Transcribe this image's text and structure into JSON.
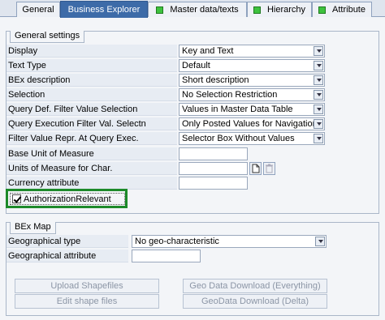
{
  "tabs": [
    {
      "label": "General"
    },
    {
      "label": "Business Explorer"
    },
    {
      "label": "Master data/texts"
    },
    {
      "label": "Hierarchy"
    },
    {
      "label": "Attribute"
    }
  ],
  "general": {
    "title": "General settings",
    "rows": [
      {
        "label": "Display",
        "value": "Key and Text"
      },
      {
        "label": "Text Type",
        "value": "Default"
      },
      {
        "label": "BEx description",
        "value": "Short description"
      },
      {
        "label": "Selection",
        "value": "No Selection Restriction"
      },
      {
        "label": "Query Def. Filter Value Selection",
        "value": "Values in Master Data Table"
      },
      {
        "label": "Query Execution Filter Val. Selectn",
        "value": "Only Posted Values for Navigation"
      },
      {
        "label": "Filter Value Repr. At Query Exec.",
        "value": "Selector Box Without Values"
      },
      {
        "label": "Base Unit of Measure",
        "value": ""
      },
      {
        "label": "Units of Measure for Char.",
        "value": ""
      },
      {
        "label": "Currency attribute",
        "value": ""
      }
    ],
    "authorization": {
      "label": "AuthorizationRelevant",
      "checked": true
    }
  },
  "bexmap": {
    "title": "BEx Map",
    "geo_type_label": "Geographical type",
    "geo_type_value": "No geo-characteristic",
    "geo_attr_label": "Geographical attribute",
    "geo_attr_value": "",
    "buttons": {
      "upload": "Upload Shapefiles",
      "geo_download_all": "Geo Data Download (Everything)",
      "edit_shape": "Edit shape files",
      "geo_download_delta": "GeoData Download (Delta)"
    }
  },
  "colors": {
    "active_tab": "#3d6ba8",
    "highlight": "#1d8a2a",
    "status_dot": "#3ec23e"
  }
}
